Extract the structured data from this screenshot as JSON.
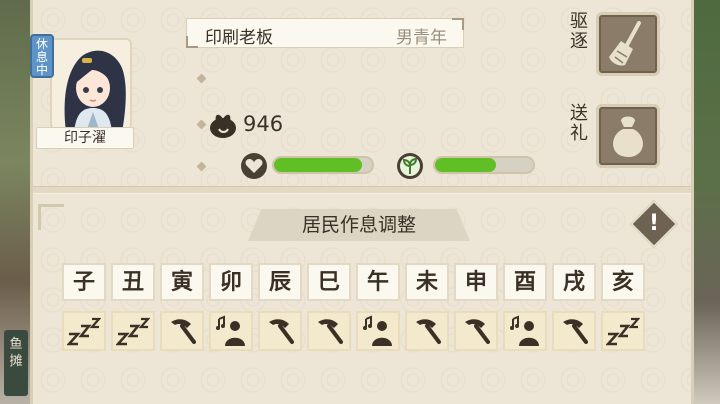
{
  "side": {
    "left_sign": "鱼\n摊"
  },
  "resident": {
    "name": "印子濯",
    "status": "休息中",
    "title": "印刷老板",
    "type": "男青年",
    "coins": "946",
    "bar_fill": [
      0.9,
      0.6
    ]
  },
  "buttons": {
    "evict_label": "驱逐",
    "gift_label": "送礼"
  },
  "schedule": {
    "title": "居民作息调整",
    "hours": [
      "子",
      "丑",
      "寅",
      "卯",
      "辰",
      "巳",
      "午",
      "未",
      "申",
      "酉",
      "戌",
      "亥"
    ],
    "activities": [
      "sleep",
      "sleep",
      "work",
      "leisure",
      "work",
      "work",
      "leisure",
      "work",
      "work",
      "leisure",
      "work",
      "sleep"
    ]
  }
}
